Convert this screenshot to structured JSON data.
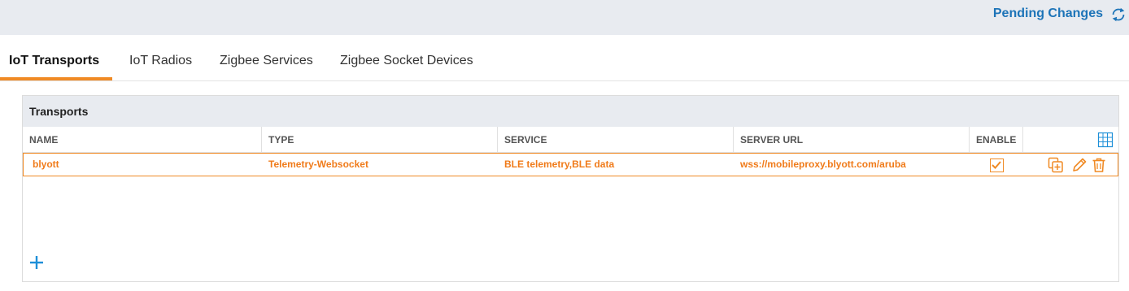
{
  "header": {
    "pending_label": "Pending Changes",
    "refresh_icon": "refresh-icon",
    "accent": "#1d74b8"
  },
  "tabs": [
    {
      "label": "IoT Transports",
      "active": true
    },
    {
      "label": "IoT Radios",
      "active": false
    },
    {
      "label": "Zigbee Services",
      "active": false
    },
    {
      "label": "Zigbee Socket Devices",
      "active": false
    }
  ],
  "panel": {
    "title": "Transports",
    "columns": [
      "NAME",
      "TYPE",
      "SERVICE",
      "SERVER URL",
      "ENABLE"
    ],
    "column_settings_icon": "table-columns-icon",
    "rows": [
      {
        "name": "blyott",
        "type": "Telemetry-Websocket",
        "service": "BLE telemetry,BLE data",
        "server_url": "wss://mobileproxy.blyott.com/aruba",
        "enabled": true
      }
    ],
    "row_actions": [
      "clone-icon",
      "edit-icon",
      "delete-icon"
    ],
    "add_icon": "plus-icon",
    "highlight_color": "#f08a24"
  }
}
